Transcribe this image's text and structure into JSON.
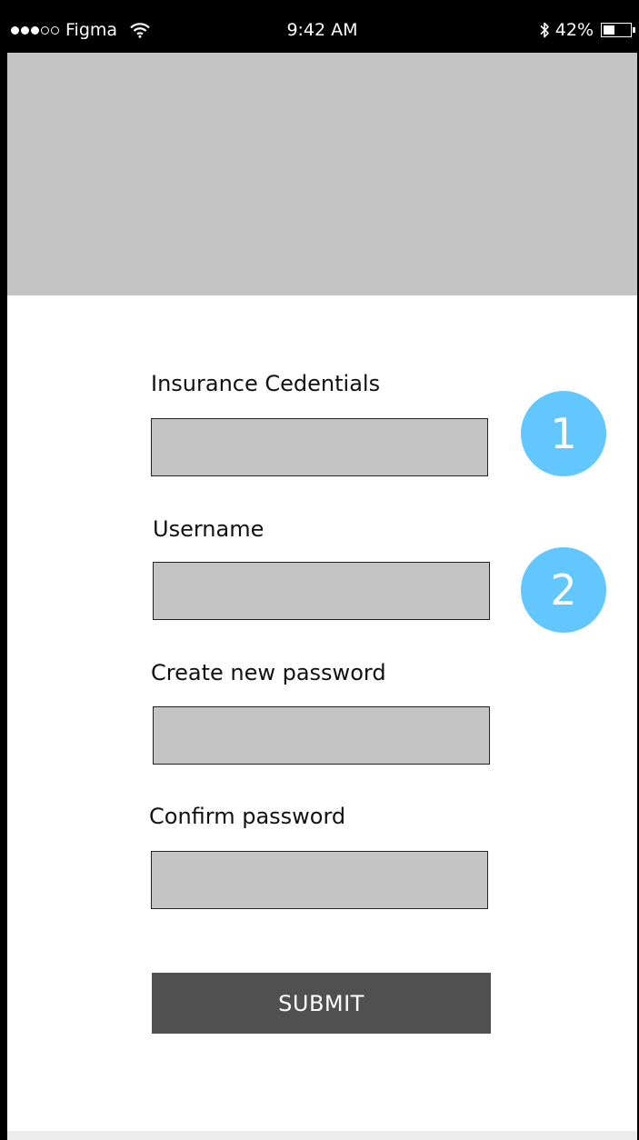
{
  "status_bar": {
    "signal_dots_filled": 3,
    "signal_dots_total": 5,
    "carrier": "Figma",
    "time": "9:42 AM",
    "battery_percent": "42%",
    "battery_level": 0.42,
    "icons": [
      "wifi-icon",
      "bluetooth-icon",
      "battery-icon"
    ]
  },
  "form": {
    "fields": [
      {
        "label": "Insurance Cedentials",
        "value": ""
      },
      {
        "label": "Username",
        "value": ""
      },
      {
        "label": "Create new password",
        "value": ""
      },
      {
        "label": "Confirm password",
        "value": ""
      }
    ],
    "submit_label": "SUBMIT"
  },
  "step_badges": [
    "1",
    "2"
  ],
  "colors": {
    "placeholder_gray": "#c4c4c4",
    "badge_blue": "#62c6ff",
    "button_dark": "#505050"
  }
}
